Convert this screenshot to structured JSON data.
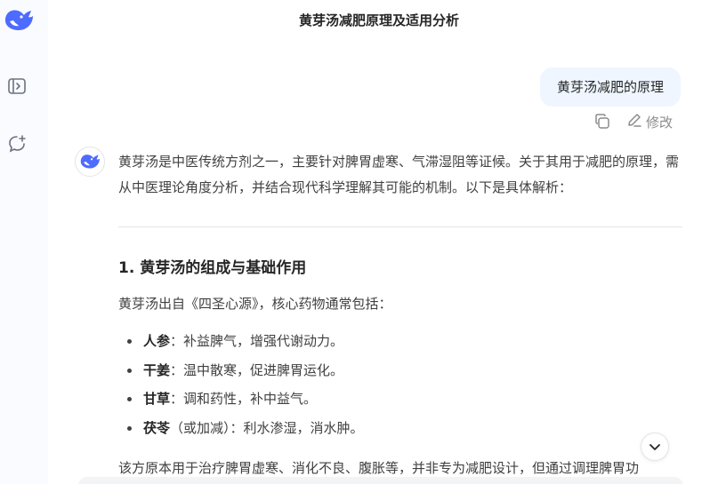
{
  "conversation_title": "黄芽汤减肥原理及适用分析",
  "user_message": "黄芽汤减肥的原理",
  "message_actions": {
    "edit_label": "修改"
  },
  "answer": {
    "intro": "黄芽汤是中医传统方剂之一，主要针对脾胃虚寒、气滞湿阻等证候。关于其用于减肥的原理，需从中医理论角度分析，并结合现代科学理解其可能的机制。以下是具体解析：",
    "section_title": "1. 黄芽汤的组成与基础作用",
    "section_intro": "黄芽汤出自《四圣心源》，核心药物通常包括：",
    "ingredients": [
      {
        "term": "人参",
        "desc": "：补益脾气，增强代谢动力。"
      },
      {
        "term": "干姜",
        "desc": "：温中散寒，促进脾胃运化。"
      },
      {
        "term": "甘草",
        "desc": "：调和药性，补中益气。"
      },
      {
        "term": "茯苓",
        "desc": "（或加减）：利水渗湿，消水肿。"
      }
    ],
    "trailing_text": "该方原本用于治疗脾胃虚寒、消化不良、腹胀等，并非专为减肥设计，但通过调理脾胃功"
  },
  "icons": {
    "logo": "whale-logo-icon",
    "sidebar_toggle": "sidebar-toggle-icon",
    "new_chat": "new-chat-icon",
    "copy": "copy-icon",
    "edit": "edit-pencil-icon",
    "scroll_down": "chevron-down-icon"
  },
  "colors": {
    "brand": "#4d6bfe",
    "user_bubble": "#eff6ff",
    "sidebar_bg": "#f9fbff"
  }
}
